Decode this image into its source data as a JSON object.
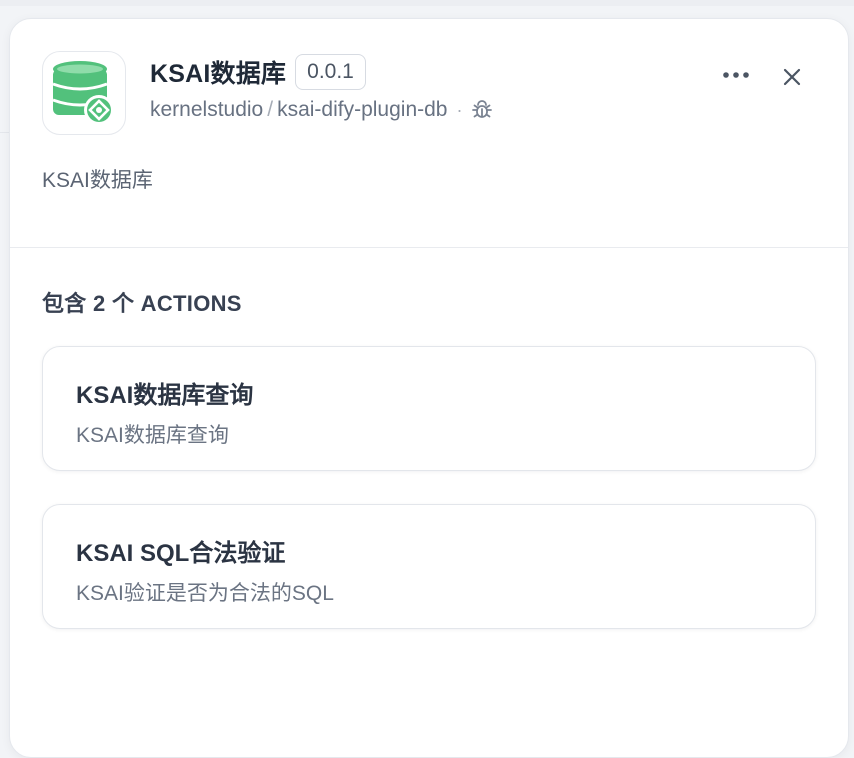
{
  "plugin": {
    "name": "KSAI数据库",
    "version": "0.0.1",
    "org": "kernelstudio",
    "separator": "/",
    "repo": "ksai-dify-plugin-db",
    "dot": "·",
    "description": "KSAI数据库",
    "icon": "database-icon"
  },
  "actions_header": "包含 2 个 ACTIONS",
  "actions": [
    {
      "title": "KSAI数据库查询",
      "description": "KSAI数据库查询"
    },
    {
      "title": "KSAI SQL合法验证",
      "description": "KSAI验证是否为合法的SQL"
    }
  ],
  "colors": {
    "accent_green": "#52c17c",
    "text_primary": "#1f2937",
    "text_secondary": "#687282"
  },
  "icons": [
    "database-icon",
    "bug-icon",
    "more-horizontal-icon",
    "close-icon"
  ]
}
